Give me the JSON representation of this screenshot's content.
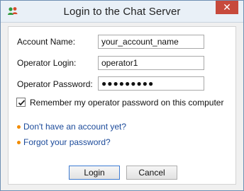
{
  "window": {
    "title": "Login to the Chat Server",
    "icon": "people-icon",
    "close_glyph": "✕"
  },
  "form": {
    "account_name_label": "Account Name:",
    "account_name_value": "your_account_name",
    "operator_login_label": "Operator Login:",
    "operator_login_value": "operator1",
    "operator_password_label": "Operator Password:",
    "operator_password_value": "●●●●●●●●●",
    "remember_checked": true,
    "remember_label": "Remember my operator password on this computer"
  },
  "links": {
    "no_account": "Don't have an account yet?",
    "forgot_password": "Forgot your password?"
  },
  "buttons": {
    "login": "Login",
    "cancel": "Cancel"
  },
  "colors": {
    "close_button": "#c74a3c",
    "link": "#1b4a9a",
    "bullet": "#f28c00",
    "default_button_border": "#3d7bd2"
  }
}
